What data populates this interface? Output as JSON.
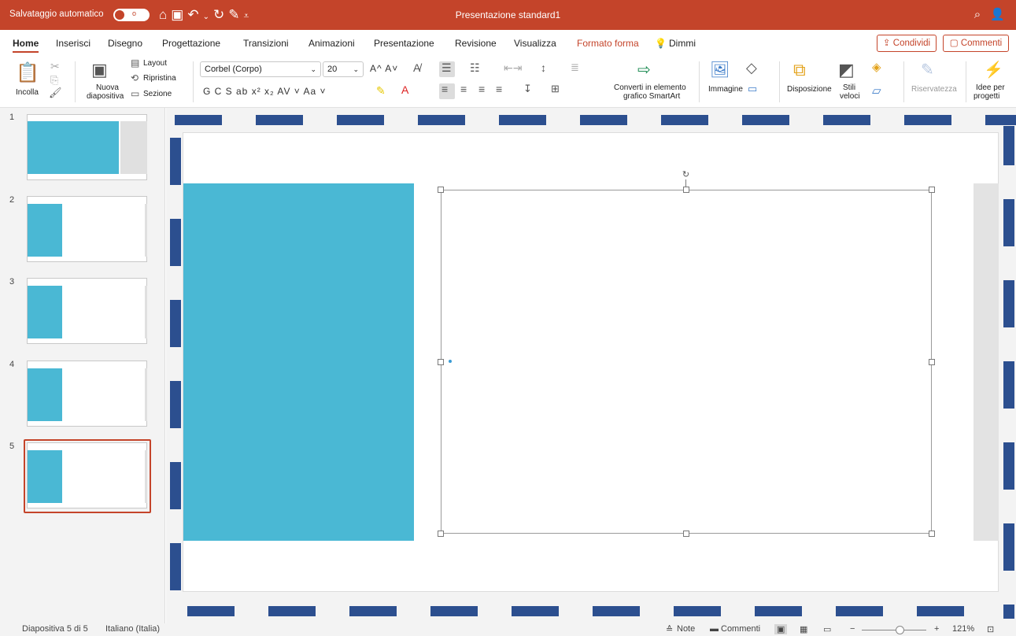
{
  "titlebar": {
    "autosave_label": "Salvataggio automatico",
    "autosave_toggle": "o",
    "quick_icons": "⌂ 🖫 ↶ ⌄ ↻ ✎ ⩡",
    "document_title": "Presentazione standard1",
    "search_icon": "search-icon",
    "user_icon": "user-icon"
  },
  "menu": {
    "tabs": [
      "Home",
      "Inserisci",
      "Disegno",
      "Progettazione",
      "Transizioni",
      "Animazioni",
      "Presentazione",
      "Revisione",
      "Visualizza",
      "Formato forma",
      "Dimmi"
    ],
    "active_tab": "Home",
    "accent_tab": "Formato forma",
    "share_label": "Condividi",
    "comments_label": "Commenti"
  },
  "ribbon": {
    "paste_label": "Incolla",
    "new_slide_label_1": "Nuova",
    "new_slide_label_2": "diapositiva",
    "layout_label": "Layout",
    "reset_label": "Ripristina",
    "section_label": "Sezione",
    "font_name": "Corbel (Corpo)",
    "font_size": "20",
    "grow_shrink": "A^ A˅",
    "format_row": "G  C  S  ab  x²  x₂  AV ˅  Aa ˅",
    "smartart_label_1": "Converti in elemento",
    "smartart_label_2": "grafico SmartArt",
    "image_label": "Immagine",
    "arrange_label": "Disposizione",
    "styles_label_1": "Stili",
    "styles_label_2": "veloci",
    "privacy_label": "Riservatezza",
    "designer_label_1": "Idee per",
    "designer_label_2": "progetti"
  },
  "slides_pane": {
    "numbers": [
      "1",
      "2",
      "3",
      "4",
      "5"
    ],
    "selected": "5"
  },
  "statusbar": {
    "slide_info": "Diapositiva 5 di 5",
    "language": "Italiano (Italia)",
    "notes_label": "Note",
    "comments_label": "Commenti",
    "zoom_minus": "−",
    "zoom_plus": "+",
    "zoom_level": "121%"
  },
  "colors": {
    "brand": "#c4442a",
    "slide_accent": "#4ab8d4",
    "dash_border": "#2c4f8f"
  }
}
